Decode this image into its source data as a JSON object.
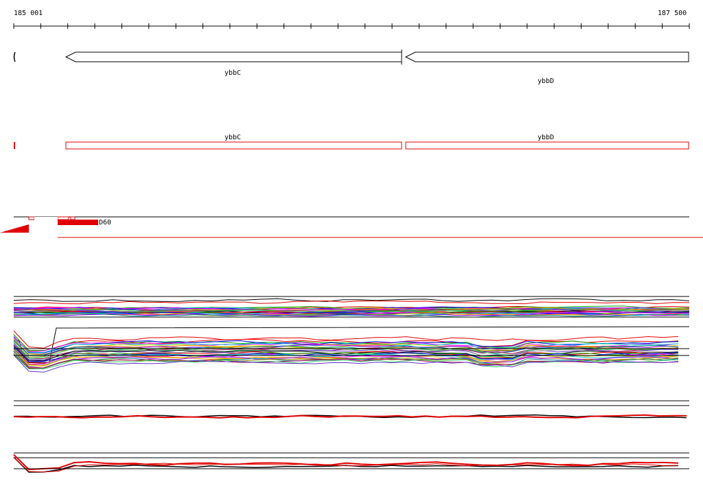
{
  "ruler": {
    "start_label": "185 001",
    "end_label": "187 500",
    "start": 185001,
    "end": 187500,
    "minor_tick_count": 26
  },
  "genes_track": {
    "genes": [
      {
        "name": "ybbC",
        "start": 185196,
        "end": 186442,
        "strand": "-"
      },
      {
        "name": "ybbD",
        "start": 186457,
        "end": 187500,
        "strand": "-"
      }
    ]
  },
  "cds_track": {
    "genes": [
      {
        "name": "ybbC",
        "start": 185196,
        "end": 186442
      },
      {
        "name": "ybbD",
        "start": 186457,
        "end": 187500
      }
    ],
    "color": "#e00000"
  },
  "feature_track": {
    "label": "D60",
    "color": "#e00000"
  },
  "colors": {
    "line": "#000000",
    "accent_red": "#e00000",
    "series_palette": [
      "#ff0000",
      "#00aa00",
      "#0000ff",
      "#ff00ff",
      "#00cccc",
      "#cccc00",
      "#ff8800",
      "#8800ff",
      "#008888",
      "#888800",
      "#aa0055",
      "#33cc66",
      "#6633cc",
      "#999999",
      "#000000"
    ]
  }
}
